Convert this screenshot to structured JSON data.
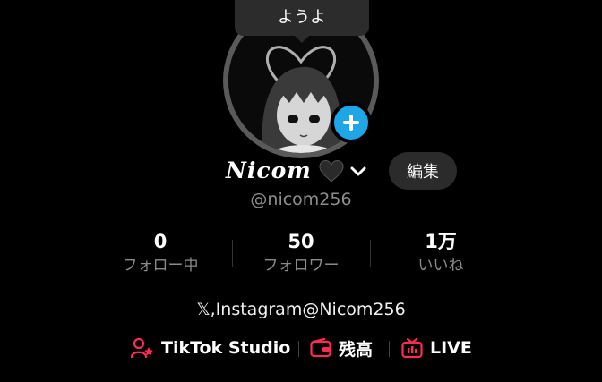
{
  "bubble": {
    "text": "ようよ"
  },
  "profile": {
    "display_name": "Nicom",
    "handle": "@nicom256",
    "edit_label": "編集",
    "bio": "𝕏,Instagram@Nicom256"
  },
  "stats": [
    {
      "value": "0",
      "label": "フォロー中"
    },
    {
      "value": "50",
      "label": "フォロワー"
    },
    {
      "value": "1万",
      "label": "いいね"
    }
  ],
  "links": [
    {
      "label": "TikTok Studio",
      "icon": "person-star-icon"
    },
    {
      "label": "残高",
      "icon": "wallet-icon"
    },
    {
      "label": "LIVE",
      "icon": "tv-live-icon"
    }
  ],
  "colors": {
    "background": "#000000",
    "accent_blue": "#1fa6e6",
    "link_icon_red": "#fe2c55",
    "muted_text": "#8a8a8a"
  }
}
